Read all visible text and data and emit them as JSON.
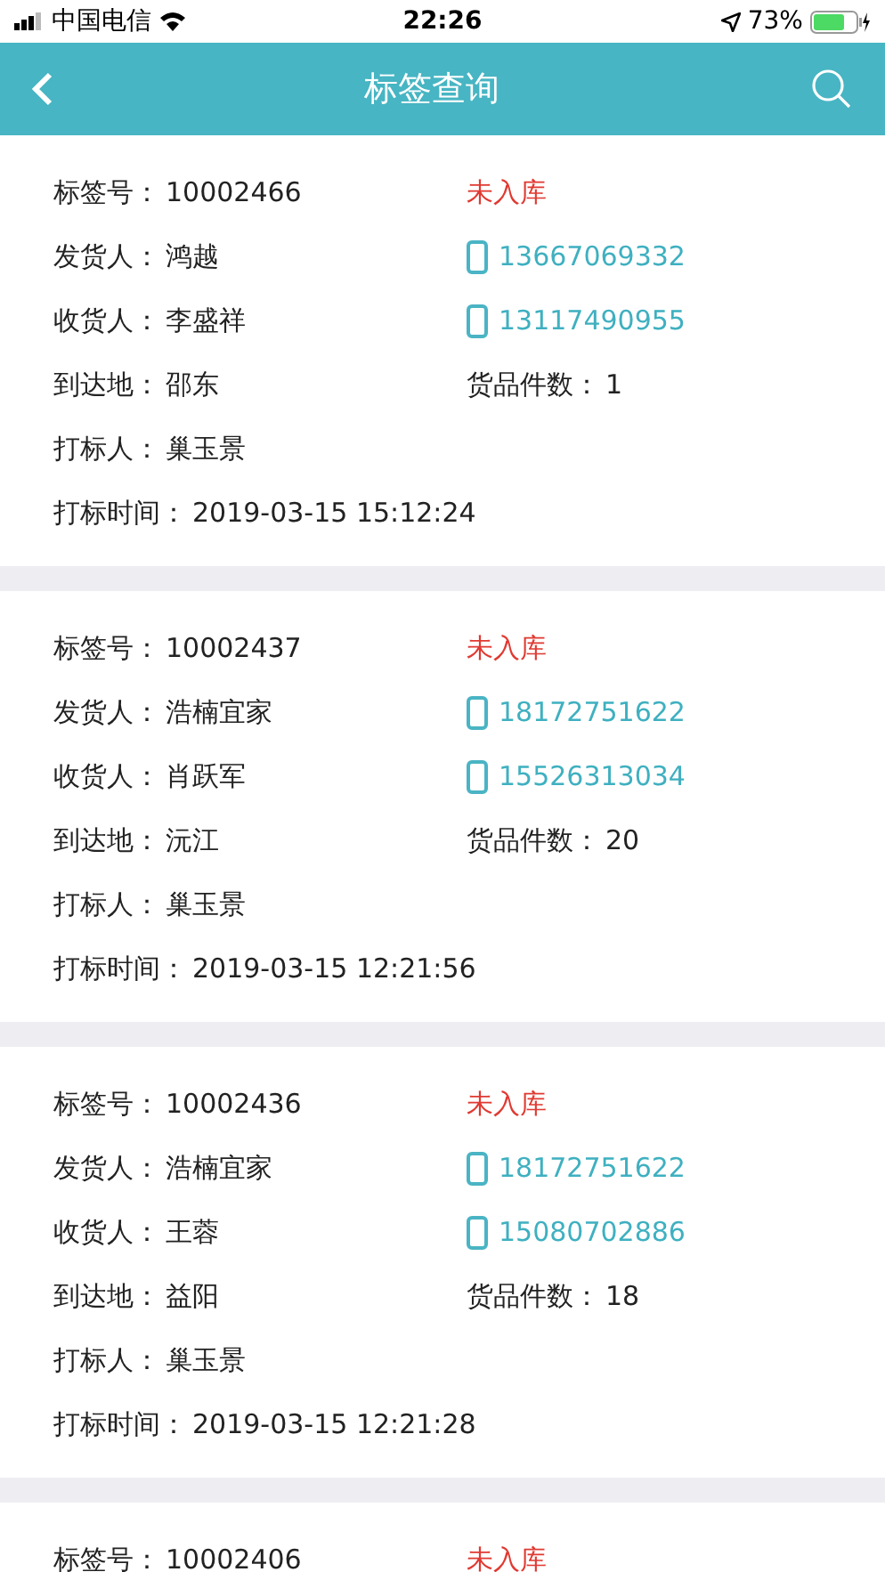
{
  "status_bar": {
    "carrier": "中国电信",
    "time": "22:26",
    "battery": "73%"
  },
  "header": {
    "title": "标签查询"
  },
  "cards": [
    {
      "tag_label": "标签号：",
      "tag_no": "10002466",
      "status": "未入库",
      "sender_label": "发货人：",
      "sender": "鸿越",
      "sender_phone": "13667069332",
      "receiver_label": "收货人：",
      "receiver": "李盛祥",
      "receiver_phone": "13117490955",
      "dest_label": "到达地：",
      "dest": "邵东",
      "count_label": "货品件数：",
      "count": "1",
      "marker_label": "打标人：",
      "marker": "巢玉景",
      "time_label": "打标时间：",
      "time": "2019-03-15 15:12:24"
    },
    {
      "tag_label": "标签号：",
      "tag_no": "10002437",
      "status": "未入库",
      "sender_label": "发货人：",
      "sender": "浩楠宜家",
      "sender_phone": "18172751622",
      "receiver_label": "收货人：",
      "receiver": "肖跃军",
      "receiver_phone": "15526313034",
      "dest_label": "到达地：",
      "dest": "沅江",
      "count_label": "货品件数：",
      "count": "20",
      "marker_label": "打标人：",
      "marker": "巢玉景",
      "time_label": "打标时间：",
      "time": "2019-03-15 12:21:56"
    },
    {
      "tag_label": "标签号：",
      "tag_no": "10002436",
      "status": "未入库",
      "sender_label": "发货人：",
      "sender": "浩楠宜家",
      "sender_phone": "18172751622",
      "receiver_label": "收货人：",
      "receiver": "王蓉",
      "receiver_phone": "15080702886",
      "dest_label": "到达地：",
      "dest": "益阳",
      "count_label": "货品件数：",
      "count": "18",
      "marker_label": "打标人：",
      "marker": "巢玉景",
      "time_label": "打标时间：",
      "time": "2019-03-15 12:21:28"
    },
    {
      "tag_label": "标签号：",
      "tag_no": "10002406",
      "status": "未入库"
    }
  ]
}
